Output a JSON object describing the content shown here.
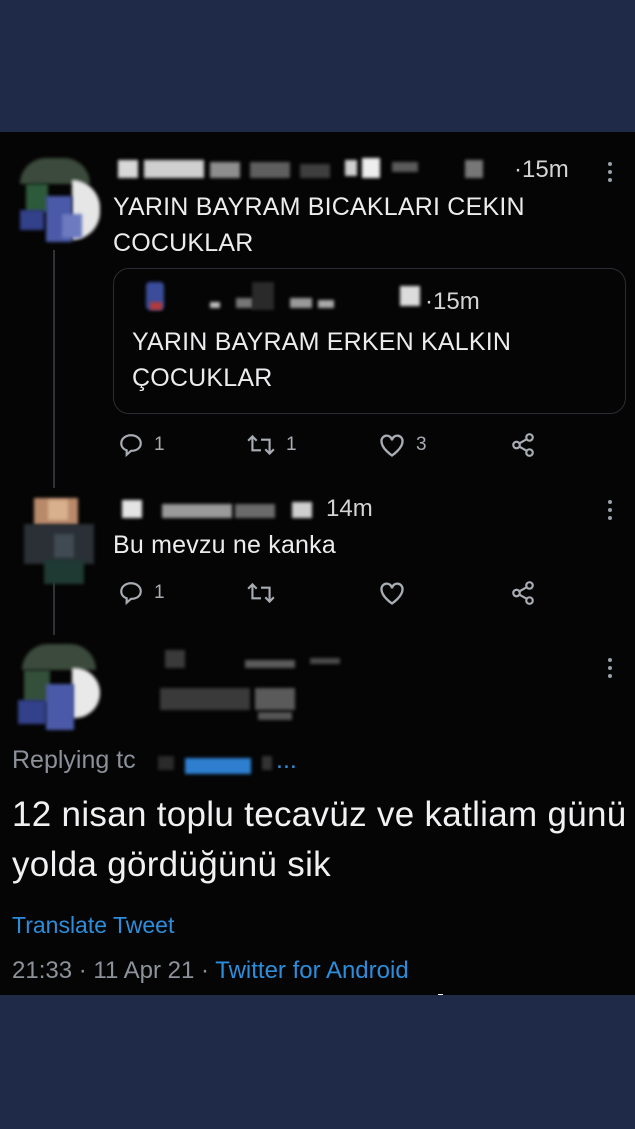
{
  "tweet1": {
    "time": "·15m",
    "text": "YARIN BAYRAM BICAKLARI CEKIN COCUKLAR",
    "quoted": {
      "time": "·15m",
      "text": "YARIN BAYRAM ERKEN KALKIN ÇOCUKLAR"
    },
    "replies": "1",
    "retweets": "1",
    "likes": "3"
  },
  "tweet2": {
    "time": "14m",
    "text": "Bu mevzu ne kanka",
    "replies": "1"
  },
  "main_tweet": {
    "replying_to": "Replying tc",
    "replying_tail": "...",
    "text": "12 nisan toplu tecavüz ve katliam günü yolda gördüğünü sik",
    "translate": "Translate Tweet",
    "timestamp": "21:33 · 11 Apr 21 · ",
    "source": "Twitter for Android"
  },
  "icons": [
    "reply-icon",
    "retweet-icon",
    "like-icon",
    "share-icon",
    "more-icon"
  ],
  "colors": {
    "link": "#2e8ddb",
    "background": "#050505",
    "frame": "#1e2a48"
  }
}
